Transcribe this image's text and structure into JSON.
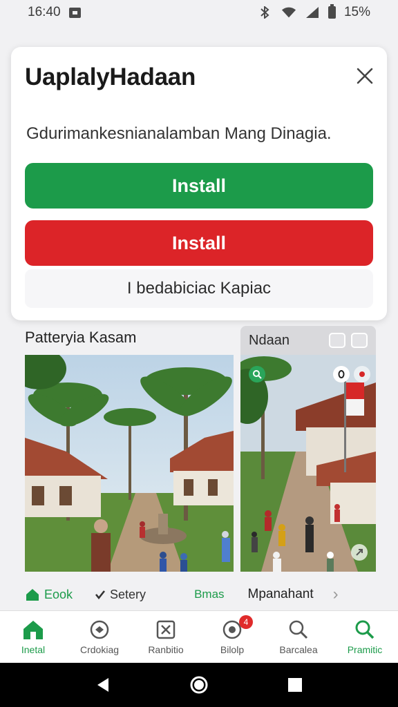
{
  "status_bar": {
    "time": "16:40",
    "battery": "15%"
  },
  "dialog": {
    "title": "UaplalyHadaan",
    "message": "Gdurimankesnianalamban Mang Dinagia.",
    "primary_button": "Install",
    "secondary_button": "Install",
    "tertiary_button": "I bedabiciac Kapiac"
  },
  "gallery": {
    "main_title": "Patteryia Kasam",
    "side_title": "Ndaan"
  },
  "chips": [
    {
      "label": "Eook"
    },
    {
      "label": "Setery"
    },
    {
      "label": "Bmas"
    },
    {
      "label": "Mpanahant"
    }
  ],
  "bottom_nav": [
    {
      "label": "Inetal"
    },
    {
      "label": "Crdokiag"
    },
    {
      "label": "Ranbitio"
    },
    {
      "label": "Bilolp",
      "badge": "4"
    },
    {
      "label": "Barcalea"
    },
    {
      "label": "Pramitic"
    }
  ],
  "colors": {
    "accent_green": "#1c9b4a",
    "accent_red": "#dc2428"
  }
}
